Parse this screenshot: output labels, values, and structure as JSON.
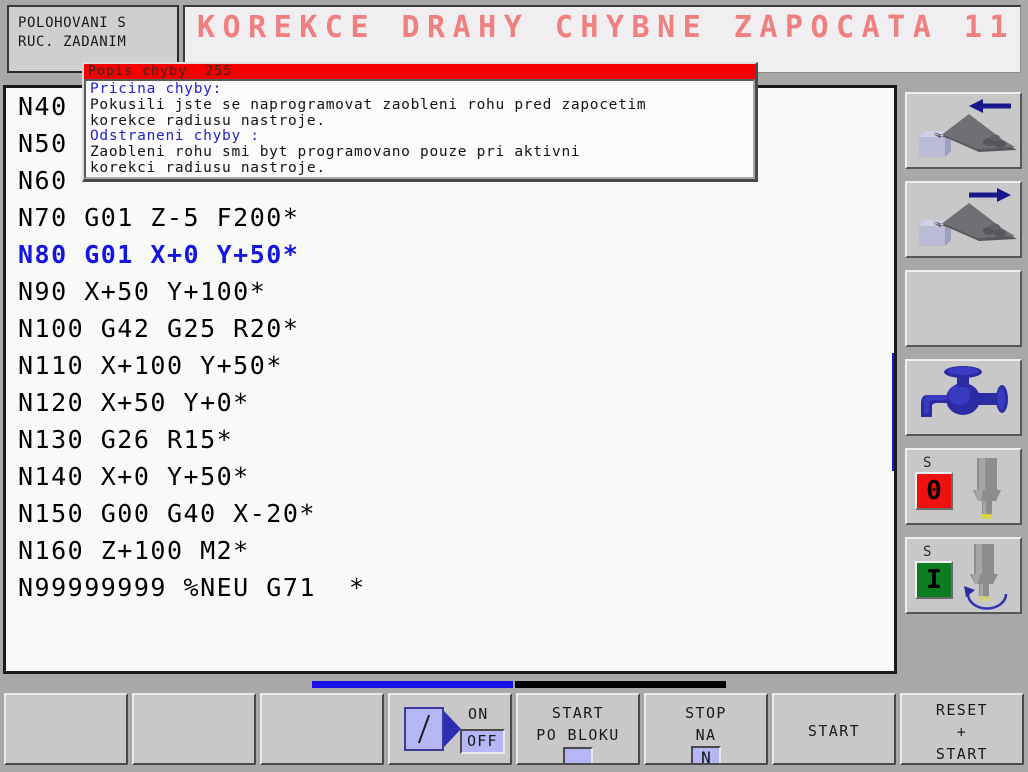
{
  "header": {
    "mode_line1": "POLOHOVANI S",
    "mode_line2": "RUC. ZADANIM",
    "title": "KOREKCE DRAHY CHYBNE ZAPOCATA 11"
  },
  "error_dialog": {
    "title": "Popis chyby  255",
    "lines": [
      {
        "text": "Pricina chyby:",
        "highlight": true
      },
      {
        "text": "Pokusili jste se naprogramovat zaobleni rohu pred zapocetim",
        "highlight": false
      },
      {
        "text": "korekce radiusu nastroje.",
        "highlight": false
      },
      {
        "text": "Odstraneni chyby :",
        "highlight": true
      },
      {
        "text": "Zaobleni rohu smi byt programovano pouze pri aktivni",
        "highlight": false
      },
      {
        "text": "korekci radiusu nastroje.",
        "highlight": false
      }
    ],
    "title_bg": "#f40000"
  },
  "program": {
    "lines": [
      {
        "text": "N40",
        "active": false
      },
      {
        "text": "N50",
        "active": false
      },
      {
        "text": "N60",
        "active": false
      },
      {
        "text": "N70 G01 Z-5 F200*",
        "active": false
      },
      {
        "text": "N80 G01 X+0 Y+50*",
        "active": true
      },
      {
        "text": "N90 X+50 Y+100*",
        "active": false
      },
      {
        "text": "N100 G42 G25 R20*",
        "active": false
      },
      {
        "text": "N110 X+100 Y+50*",
        "active": false
      },
      {
        "text": "N120 X+50 Y+0*",
        "active": false
      },
      {
        "text": "N130 G26 R15*",
        "active": false
      },
      {
        "text": "N140 X+0 Y+50*",
        "active": false
      },
      {
        "text": "N150 G00 G40 X-20*",
        "active": false
      },
      {
        "text": "N160 Z+100 M2*",
        "active": false
      },
      {
        "text": "N99999999 %NEU G71  *",
        "active": false
      }
    ],
    "active_color": "#1515e0",
    "scrollbar_color": "#1a12e8"
  },
  "vertical_keys": [
    {
      "name": "chip-conveyor-reverse",
      "icon": "conveyor-arrow-left"
    },
    {
      "name": "chip-conveyor-forward",
      "icon": "conveyor-arrow-right"
    },
    {
      "name": "blank-key",
      "icon": "none"
    },
    {
      "name": "coolant-on",
      "icon": "faucet"
    },
    {
      "name": "spindle-stop",
      "icon": "spindle-stop",
      "letter": "S",
      "state": "0"
    },
    {
      "name": "spindle-start",
      "icon": "spindle-start",
      "letter": "S",
      "state": "I"
    }
  ],
  "softkeys": [
    {
      "label": "",
      "type": "blank"
    },
    {
      "label": "",
      "type": "blank"
    },
    {
      "label": "",
      "type": "blank"
    },
    {
      "type": "toggle",
      "on_label": "ON",
      "off_label": "OFF",
      "selected": "OFF"
    },
    {
      "type": "text2swatch",
      "line1": "START",
      "line2": "PO BLOKU"
    },
    {
      "type": "text2box",
      "line1": "STOP",
      "line2": "NA",
      "box_char": "N"
    },
    {
      "type": "text1",
      "line1": "START"
    },
    {
      "type": "text3",
      "line1": "RESET",
      "line2": "+",
      "line3": "START"
    }
  ]
}
